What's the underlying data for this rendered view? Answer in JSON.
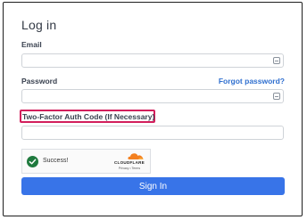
{
  "login": {
    "title": "Log in",
    "email_label": "Email",
    "email_value": "",
    "password_label": "Password",
    "password_value": "",
    "forgot_password_link": "Forgot password?",
    "twofa_label": "Two-Factor Auth Code (If Necessary)",
    "twofa_value": "",
    "sign_in_button": "Sign In"
  },
  "captcha": {
    "status_text": "Success!",
    "brand": "CLOUDFLARE",
    "privacy_link": "Privacy",
    "separator": "•",
    "terms_link": "Terms"
  },
  "icons": {
    "autofill": "autofill-icon",
    "check": "check-circle-icon",
    "cloud": "cloudflare-logo-icon"
  },
  "colors": {
    "accent": "#3874e8",
    "link": "#2f6fcf",
    "highlight": "#d21f5c",
    "success": "#1f7a3e",
    "cloudflare_orange": "#f38020"
  }
}
